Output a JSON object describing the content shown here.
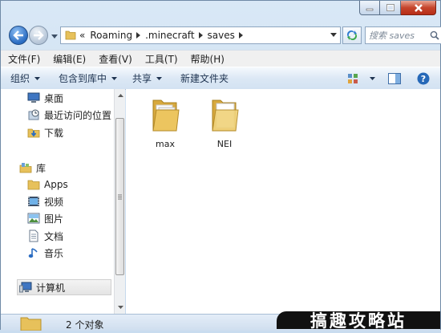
{
  "address": {
    "overflow_glyph": "«",
    "crumbs": [
      "Roaming",
      ".minecraft",
      "saves"
    ]
  },
  "search": {
    "placeholder": "搜索 saves"
  },
  "menu": [
    "文件(F)",
    "编辑(E)",
    "查看(V)",
    "工具(T)",
    "帮助(H)"
  ],
  "commands": {
    "organize": "组织",
    "include_in_library": "包含到库中",
    "share": "共享",
    "new_folder": "新建文件夹"
  },
  "nav": {
    "favorites": [
      "桌面",
      "最近访问的位置",
      "下载"
    ],
    "library": "库",
    "library_items": [
      "Apps",
      "视频",
      "图片",
      "文档",
      "音乐"
    ],
    "computer": "计算机"
  },
  "files": [
    {
      "name": "max"
    },
    {
      "name": "NEI"
    }
  ],
  "status": {
    "text": "2 个对象"
  },
  "watermark": {
    "text": "搞趣攻略站"
  },
  "colors": {
    "folder": "#e7c15b",
    "accent_blue": "#2a6cc2",
    "close_red": "#c5452c"
  }
}
